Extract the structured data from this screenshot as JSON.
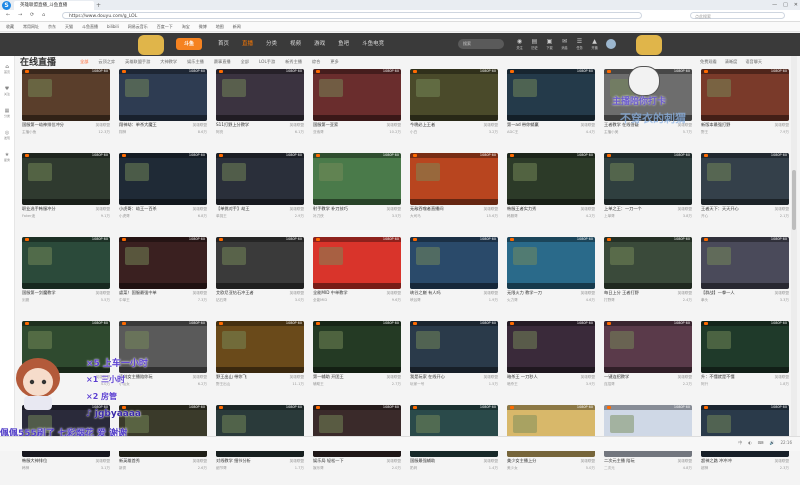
{
  "browser": {
    "tab_title": "英雄联盟直播_斗鱼直播",
    "new_tab": "+",
    "win_controls": [
      "—",
      "□",
      "✕"
    ],
    "nav_back": "←",
    "nav_forward": "→",
    "nav_reload": "⟳",
    "nav_home": "⌂",
    "url": "https://www.douyu.com/g_LOL",
    "search_placeholder": "点此搜索",
    "bookmarks": [
      "收藏",
      "常用网址",
      "京东",
      "天猫",
      "斗鱼直播",
      "bilibili",
      "网易云音乐",
      "百度一下",
      "淘宝",
      "微博",
      "地图",
      "新闻"
    ]
  },
  "site": {
    "logo": "斗鱼",
    "nav": [
      {
        "label": "首页",
        "active": false
      },
      {
        "label": "直播",
        "active": true
      },
      {
        "label": "分类",
        "active": false
      },
      {
        "label": "视频",
        "active": false
      },
      {
        "label": "游戏",
        "active": false
      },
      {
        "label": "鱼吧",
        "active": false
      },
      {
        "label": "斗鱼电竞",
        "active": false
      }
    ],
    "search_placeholder": "搜索",
    "icons": [
      {
        "glyph": "◉",
        "label": "关注"
      },
      {
        "glyph": "▤",
        "label": "历史"
      },
      {
        "glyph": "▣",
        "label": "下载"
      },
      {
        "glyph": "✉",
        "label": "消息"
      },
      {
        "glyph": "☰",
        "label": "任务"
      },
      {
        "glyph": "▲",
        "label": "开播"
      }
    ]
  },
  "rail": [
    {
      "glyph": "⌂",
      "label": "首页"
    },
    {
      "glyph": "♥",
      "label": "关注"
    },
    {
      "glyph": "▦",
      "label": "分类"
    },
    {
      "glyph": "◎",
      "label": "发现"
    },
    {
      "glyph": "★",
      "label": "星秀"
    }
  ],
  "page": {
    "title": "在线直播",
    "filters": [
      "全部",
      "云顶之弈",
      "英雄联盟手游",
      "大神教学",
      "娱乐主播",
      "赛事直播",
      "全部",
      "LOL手游",
      "新秀主播",
      "综合",
      "更多"
    ],
    "selected_filter": "全部",
    "right_tools": [
      "免费观看",
      "清晰度",
      "语音聊天"
    ]
  },
  "cards": [
    {
      "title": "国服第一劫神排位冲分",
      "tag": "英雄联盟",
      "name": "主播小鱼",
      "viewers": "12.3万",
      "color": "#5a3e2b"
    },
    {
      "title": "翔神劫：单杀大魔王",
      "tag": "英雄联盟",
      "name": "翔神",
      "viewers": "8.6万",
      "color": "#2e3c52"
    },
    {
      "title": "S11打野上分教学",
      "tag": "英雄联盟",
      "name": "阿亮",
      "viewers": "6.1万",
      "color": "#3b3340"
    },
    {
      "title": "国服第一亚索",
      "tag": "英雄联盟",
      "name": "亚索哥",
      "viewers": "10.2万",
      "color": "#6a2d2d"
    },
    {
      "title": "今晚必上王者",
      "tag": "英雄联盟",
      "name": "小白",
      "viewers": "3.2万",
      "color": "#4a4a2a"
    },
    {
      "title": "第一ad 带你躺赢",
      "tag": "英雄联盟",
      "name": "ADC王",
      "viewers": "4.4万",
      "color": "#243a4a"
    },
    {
      "title": "王者教学 在线答疑",
      "tag": "英雄联盟",
      "name": "主播小美",
      "viewers": "5.7万",
      "color": "#6d6d6d"
    },
    {
      "title": "新版本最强打野",
      "tag": "英雄联盟",
      "name": "野王",
      "viewers": "7.9万",
      "color": "#7a3a2a"
    },
    {
      "title": "职业选手韩服冲分",
      "tag": "英雄联盟",
      "name": "Faker迷",
      "viewers": "9.1万",
      "color": "#2f3a2f"
    },
    {
      "title": "小虎哥：劫王一百杀",
      "tag": "英雄联盟",
      "name": "小虎哥",
      "viewers": "6.8万",
      "color": "#1f2a36"
    },
    {
      "title": "【单挑对手】劫王",
      "tag": "英雄联盟",
      "name": "单挑王",
      "viewers": "2.9万",
      "color": "#2a2f3a"
    },
    {
      "title": "射手教学 补刀技巧",
      "tag": "英雄联盟",
      "name": "补刀侠",
      "viewers": "3.5万",
      "color": "#4a7a4a"
    },
    {
      "title": "无敌吞噬者直播间",
      "tag": "英雄联盟",
      "name": "大司马",
      "viewers": "15.6万",
      "color": "#b8451f"
    },
    {
      "title": "韩服王者实力秀",
      "tag": "英雄联盟",
      "name": "韩服哥",
      "viewers": "4.2万",
      "color": "#2c3a28"
    },
    {
      "title": "上单之王：一刀一个",
      "tag": "英雄联盟",
      "name": "上单哥",
      "viewers": "3.8万",
      "color": "#2f3f3f"
    },
    {
      "title": "王者天下：天天开心",
      "tag": "英雄联盟",
      "name": "开心",
      "viewers": "2.1万",
      "color": "#34404a"
    },
    {
      "title": "国服第一剑魔教学",
      "tag": "英雄联盟",
      "name": "剑魔",
      "viewers": "5.5万",
      "color": "#2b4a3a"
    },
    {
      "title": "虐菜！国服最强中单",
      "tag": "英雄联盟",
      "name": "中单王",
      "viewers": "7.3万",
      "color": "#3a2020"
    },
    {
      "title": "艾欧尼亚钻石冲王者",
      "tag": "英雄联盟",
      "name": "钻石哥",
      "viewers": "3.0万",
      "color": "#3a3a3a"
    },
    {
      "title": "全能MID 中单教学",
      "tag": "英雄联盟",
      "name": "全能MID",
      "viewers": "9.6万",
      "color": "#d9342b"
    },
    {
      "title": "峡谷之巅 有人吗",
      "tag": "英雄联盟",
      "name": "峡谷哥",
      "viewers": "1.9万",
      "color": "#2a4a6a"
    },
    {
      "title": "无限火力 教学一刀",
      "tag": "英雄联盟",
      "name": "火力哥",
      "viewers": "4.6万",
      "color": "#2a6a8a"
    },
    {
      "title": "每日上分 王者打野",
      "tag": "英雄联盟",
      "name": "打野哥",
      "viewers": "2.4万",
      "color": "#3a4a3a"
    },
    {
      "title": "【群战】一拳一人",
      "tag": "英雄联盟",
      "name": "拳头",
      "viewers": "3.3万",
      "color": "#4a4a5a"
    },
    {
      "title": "顶级上单 教学直播",
      "tag": "英雄联盟",
      "name": "上单教学",
      "viewers": "4.0万",
      "color": "#2f4a2f"
    },
    {
      "title": "清纯女主播陪你玩",
      "tag": "英雄联盟",
      "name": "小仙女",
      "viewers": "6.2万",
      "color": "#5a5a5a"
    },
    {
      "title": "野王出山 带你飞",
      "tag": "英雄联盟",
      "name": "野王出山",
      "viewers": "11.1万",
      "color": "#6a4a1a"
    },
    {
      "title": "第一辅助 开团王",
      "tag": "英雄联盟",
      "name": "辅助王",
      "viewers": "2.7万",
      "color": "#243a24"
    },
    {
      "title": "我是玩家 在线开心",
      "tag": "英雄联盟",
      "name": "玩家一号",
      "viewers": "1.5万",
      "color": "#2a3a4a"
    },
    {
      "title": "暗杀王 一刀秒人",
      "tag": "英雄联盟",
      "name": "暗杀王",
      "viewers": "3.9万",
      "color": "#3a2a3a"
    },
    {
      "title": "一键连招教学",
      "tag": "英雄联盟",
      "name": "连招哥",
      "viewers": "2.2万",
      "color": "#5a3a4a"
    },
    {
      "title": "升：不懂就是不懂",
      "tag": "英雄联盟",
      "name": "阿升",
      "viewers": "1.8万",
      "color": "#1f3a2a"
    },
    {
      "title": "韩服大神排位",
      "tag": "英雄联盟",
      "name": "韩神",
      "viewers": "3.1万",
      "color": "#2a2a3a"
    },
    {
      "title": "新英雄首秀",
      "tag": "英雄联盟",
      "name": "新秀",
      "viewers": "2.6万",
      "color": "#3a3a2a"
    },
    {
      "title": "对线教学 细节分析",
      "tag": "英雄联盟",
      "name": "细节哥",
      "viewers": "1.7万",
      "color": "#2a3a3a"
    },
    {
      "title": "娱乐局 轻松一下",
      "tag": "英雄联盟",
      "name": "娱乐哥",
      "viewers": "2.0万",
      "color": "#3a2a2a"
    },
    {
      "title": "国服最强辅助",
      "tag": "英雄联盟",
      "name": "奶妈",
      "viewers": "1.4万",
      "color": "#2a4a4a"
    },
    {
      "title": "美少女主播上分",
      "tag": "英雄联盟",
      "name": "美少女",
      "viewers": "5.0万",
      "color": "#d8b86a"
    },
    {
      "title": "二次元主播 陪玩",
      "tag": "英雄联盟",
      "name": "二次元",
      "viewers": "4.8万",
      "color": "#cfd8e6"
    },
    {
      "title": "超神之路 冲冲冲",
      "tag": "英雄联盟",
      "name": "超神",
      "viewers": "2.3万",
      "color": "#2a3a4a"
    }
  ],
  "card_quality": "1080P 60",
  "overlay": {
    "right_text": "主播陪你打卡",
    "watermark": "不穿衣的刺猬",
    "gift1": "×5  上车一小时",
    "gift2": "×1  三小时",
    "gift3": "×2  房管",
    "tiktok": "♪ jgbyaaaa",
    "bottom": "佩佩555刷了 七彩烟花 爱 谢谢"
  },
  "taskbar": {
    "right": [
      "中",
      "◐",
      "⌨",
      "🔊",
      "22:16"
    ]
  },
  "colors": {
    "accent": "#ff7a00",
    "header_bg": "#3a3a3a"
  }
}
